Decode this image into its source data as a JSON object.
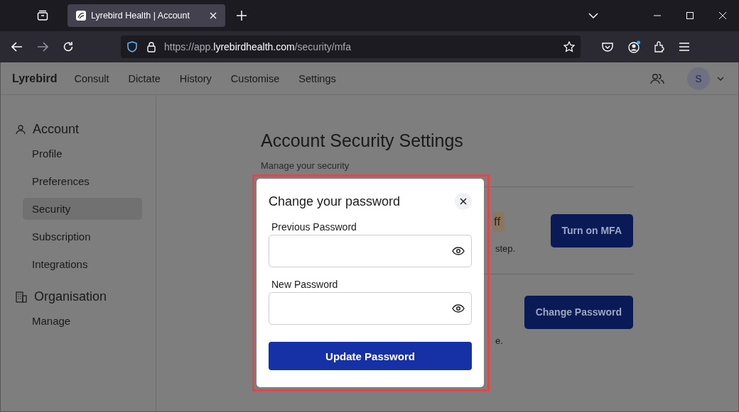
{
  "browser": {
    "tab_title": "Lyrebird Health | Account",
    "url_prefix": "https://app.",
    "url_domain": "lyrebirdhealth.com",
    "url_path": "/security/mfa"
  },
  "app": {
    "brand": "Lyrebird",
    "nav": [
      {
        "label": "Consult"
      },
      {
        "label": "Dictate"
      },
      {
        "label": "History"
      },
      {
        "label": "Customise"
      },
      {
        "label": "Settings"
      }
    ],
    "avatar": "S"
  },
  "sidebar": {
    "sections": [
      {
        "title": "Account",
        "kind": "person",
        "items": [
          {
            "label": "Profile",
            "selected": false
          },
          {
            "label": "Preferences",
            "selected": false
          },
          {
            "label": "Security",
            "selected": true
          },
          {
            "label": "Subscription",
            "selected": false
          },
          {
            "label": "Integrations",
            "selected": false
          }
        ]
      },
      {
        "title": "Organisation",
        "kind": "building",
        "items": [
          {
            "label": "Manage",
            "selected": false
          }
        ]
      }
    ]
  },
  "content": {
    "title": "Account Security Settings",
    "subtitle": "Manage your security",
    "mfa": {
      "badge": "ff",
      "text": "step.",
      "button": "Turn on MFA"
    },
    "password": {
      "text": "e.",
      "button": "Change Password"
    }
  },
  "modal": {
    "title": "Change your password",
    "fields": [
      {
        "label": "Previous Password"
      },
      {
        "label": "New Password"
      }
    ],
    "submit": "Update Password"
  }
}
